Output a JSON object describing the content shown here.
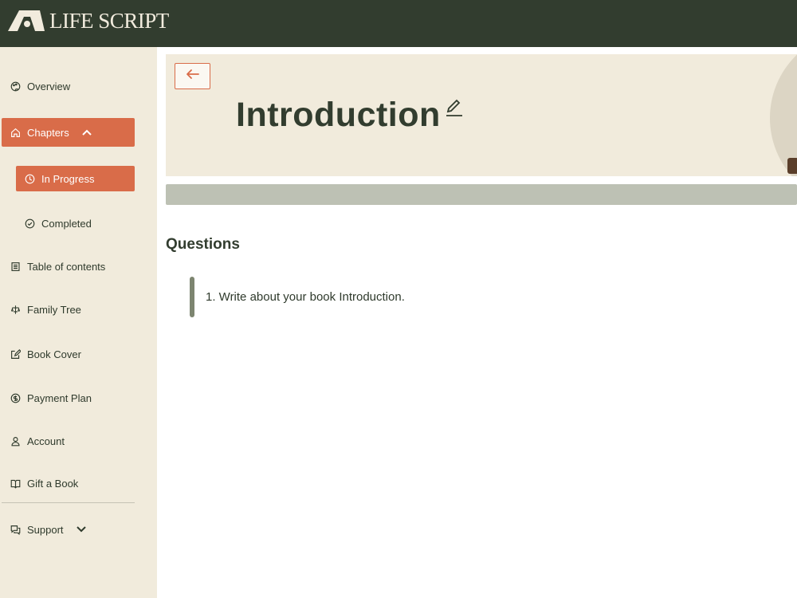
{
  "brand": {
    "name": "LIFE SCRIPT"
  },
  "sidebar": {
    "items": [
      {
        "label": "Overview",
        "icon": "palette-icon"
      },
      {
        "label": "Chapters",
        "icon": "home-icon",
        "expanded": true
      },
      {
        "label": "In Progress",
        "icon": "clock-icon"
      },
      {
        "label": "Completed",
        "icon": "check-circle-icon"
      },
      {
        "label": "Table of contents",
        "icon": "list-icon"
      },
      {
        "label": "Family Tree",
        "icon": "tree-icon"
      },
      {
        "label": "Book Cover",
        "icon": "edit-square-icon"
      },
      {
        "label": "Payment Plan",
        "icon": "dollar-circle-icon"
      },
      {
        "label": "Account",
        "icon": "user-icon"
      },
      {
        "label": "Gift a Book",
        "icon": "book-open-icon"
      },
      {
        "label": "Support",
        "icon": "chat-icon",
        "expanded": false
      }
    ]
  },
  "page": {
    "title": "Introduction",
    "questions_heading": "Questions",
    "questions": [
      {
        "text": "1. Write about your book Introduction."
      }
    ]
  },
  "colors": {
    "header_bg": "#323d2f",
    "sidebar_bg": "#f1ebdc",
    "accent": "#d96c49",
    "progress_bg": "#bdc1b4"
  }
}
